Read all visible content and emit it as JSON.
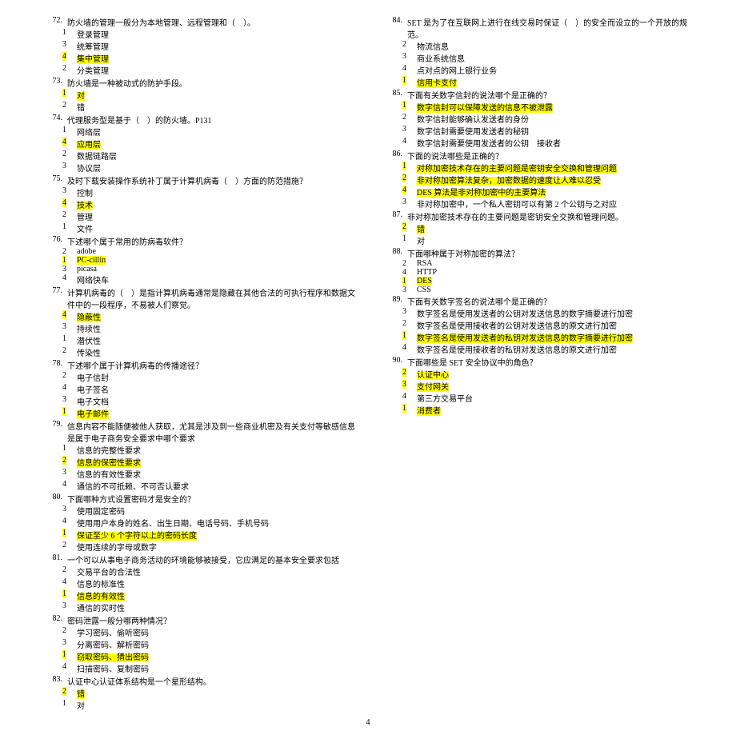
{
  "page_number": "4",
  "left": [
    {
      "n": "72.",
      "t": "防火墙的管理一般分为本地管理、远程管理和（　）。",
      "opts": [
        {
          "n": "1",
          "t": "登录管理",
          "hl": false
        },
        {
          "n": "3",
          "t": "统筹管理",
          "hl": false
        },
        {
          "n": "4",
          "t": "集中管理",
          "hl": true
        },
        {
          "n": "2",
          "t": "分类管理",
          "hl": false
        }
      ]
    },
    {
      "n": "73.",
      "t": "防火墙是一种被动式的防护手段。",
      "opts": [
        {
          "n": "1",
          "t": "对",
          "hl": true
        },
        {
          "n": "2",
          "t": "错",
          "hl": false
        }
      ]
    },
    {
      "n": "74.",
      "t": "代理服务型是基于（　）的防火墙。P131",
      "opts": [
        {
          "n": "1",
          "t": "网络层",
          "hl": false
        },
        {
          "n": "4",
          "t": "应用层",
          "hl": true
        },
        {
          "n": "2",
          "t": "数据链路层",
          "hl": false
        },
        {
          "n": "3",
          "t": "协议层",
          "hl": false
        }
      ]
    },
    {
      "n": "75.",
      "t": "及时下载安装操作系统补丁属于计算机病毒（　）方面的防范措施？",
      "opts": [
        {
          "n": "3",
          "t": "控制",
          "hl": false
        },
        {
          "n": "4",
          "t": "技术",
          "hl": true
        },
        {
          "n": "2",
          "t": "管理",
          "hl": false
        },
        {
          "n": "1",
          "t": "文件",
          "hl": false
        }
      ]
    },
    {
      "n": "76.",
      "t": "下述哪个属于常用的防病毒软件？",
      "opts": [
        {
          "n": "2",
          "t": "adobe",
          "hl": false
        },
        {
          "n": "1",
          "t": "PC-cillin",
          "hl": true
        },
        {
          "n": "3",
          "t": "picasa",
          "hl": false
        },
        {
          "n": "4",
          "t": "网络快车",
          "hl": false
        }
      ]
    },
    {
      "n": "77.",
      "t": "计算机病毒的（　）是指计算机病毒通常是隐藏在其他合法的可执行程序和数据文件中的一段程序，不易被人们察觉。",
      "opts": [
        {
          "n": "4",
          "t": "隐蔽性",
          "hl": true
        },
        {
          "n": "3",
          "t": "持续性",
          "hl": false
        },
        {
          "n": "1",
          "t": "潜伏性",
          "hl": false
        },
        {
          "n": "2",
          "t": "传染性",
          "hl": false
        }
      ]
    },
    {
      "n": "78.",
      "t": "下述哪个属于计算机病毒的传播途径？",
      "opts": [
        {
          "n": "2",
          "t": "电子信封",
          "hl": false
        },
        {
          "n": "4",
          "t": "电子签名",
          "hl": false
        },
        {
          "n": "3",
          "t": "电子文档",
          "hl": false
        },
        {
          "n": "1",
          "t": "电子邮件",
          "hl": true
        }
      ]
    },
    {
      "n": "79.",
      "t": "信息内容不能随便被他人获取，尤其是涉及到一些商业机密及有关支付等敏感信息是属于电子商务安全要求中哪个要求",
      "opts": [
        {
          "n": "1",
          "t": "信息的完整性要求",
          "hl": false
        },
        {
          "n": "2",
          "t": "信息的保密性要求",
          "hl": true
        },
        {
          "n": "3",
          "t": "信息的有效性要求",
          "hl": false
        },
        {
          "n": "4",
          "t": "通信的不可抵赖、不可否认要求",
          "hl": false
        }
      ]
    },
    {
      "n": "80.",
      "t": "下面哪种方式设置密码才是安全的？",
      "opts": [
        {
          "n": "3",
          "t": "使用固定密码",
          "hl": false
        },
        {
          "n": "4",
          "t": "使用用户本身的姓名、出生日期、电话号码、手机号码",
          "hl": false
        },
        {
          "n": "1",
          "t": "保证至少 6 个字符以上的密码长度",
          "hl": true
        },
        {
          "n": "2",
          "t": "使用连续的字母或数字",
          "hl": false
        }
      ]
    },
    {
      "n": "81.",
      "t": "一个可以从事电子商务活动的环境能够被接受，它应满足的基本安全要求包括",
      "opts": [
        {
          "n": "2",
          "t": "交易平台的合法性",
          "hl": false
        },
        {
          "n": "4",
          "t": "信息的标准性",
          "hl": false
        },
        {
          "n": "1",
          "t": "信息的有效性",
          "hl": true
        },
        {
          "n": "3",
          "t": "通信的实时性",
          "hl": false
        }
      ]
    },
    {
      "n": "82.",
      "t": "密码泄露一般分哪两种情况？",
      "opts": [
        {
          "n": "2",
          "t": "学习密码、偷听密码",
          "hl": false
        },
        {
          "n": "3",
          "t": "分离密码、解析密码",
          "hl": false
        },
        {
          "n": "1",
          "t": "窃取密码、猜出密码",
          "hl": true
        },
        {
          "n": "4",
          "t": "扫描密码、复制密码",
          "hl": false
        }
      ]
    },
    {
      "n": "83.",
      "t": "认证中心认证体系结构是一个星形结构。",
      "opts": [
        {
          "n": "2",
          "t": "错",
          "hl": true
        },
        {
          "n": "1",
          "t": "对",
          "hl": false
        }
      ]
    }
  ],
  "right": [
    {
      "n": "84.",
      "t": "SET 是为了在互联网上进行在线交易时保证（　）的安全而设立的一个开放的规范。",
      "opts": [
        {
          "n": "2",
          "t": "物流信息",
          "hl": false
        },
        {
          "n": "3",
          "t": "商业系统信息",
          "hl": false
        },
        {
          "n": "4",
          "t": "点对点的网上银行业务",
          "hl": false
        },
        {
          "n": "1",
          "t": "信用卡支付",
          "hl": true
        }
      ]
    },
    {
      "n": "85.",
      "t": "下面有关数字信封的说法哪个是正确的？",
      "opts": [
        {
          "n": "1",
          "t": "数字信封可以保障发送的信息不被泄露",
          "hl": true
        },
        {
          "n": "2",
          "t": "数字信封能够确认发送者的身份",
          "hl": false
        },
        {
          "n": "3",
          "t": "数字信封需要使用发送者的秘钥",
          "hl": false
        },
        {
          "n": "4",
          "t": "数字信封需要使用发送者的公钥　接收者",
          "hl": false
        }
      ]
    },
    {
      "n": "86.",
      "t": "下面的说法哪些是正确的？",
      "opts": [
        {
          "n": "1",
          "t": "对称加密技术存在的主要问题是密钥安全交换和管理问题",
          "hl": true
        },
        {
          "n": "2",
          "t": "非对称加密算法复杂，加密数据的速度让人难以忍受",
          "hl": true
        },
        {
          "n": "4",
          "t": "DES 算法是非对称加密中的主要算法",
          "hl": true
        },
        {
          "n": "3",
          "t": "非对称加密中，一个私人密钥可以有第 2 个公钥与之对应",
          "hl": false
        }
      ]
    },
    {
      "n": "87.",
      "t": "非对称加密技术存在的主要问题是密钥安全交换和管理问题。",
      "opts": [
        {
          "n": "2",
          "t": "错",
          "hl": true
        },
        {
          "n": "1",
          "t": "对",
          "hl": false
        }
      ]
    },
    {
      "n": "88.",
      "t": "下面哪种属于对称加密的算法？",
      "opts": [
        {
          "n": "2",
          "t": "RSA",
          "hl": false
        },
        {
          "n": "4",
          "t": "HTTP",
          "hl": false
        },
        {
          "n": "1",
          "t": "DES",
          "hl": true
        },
        {
          "n": "3",
          "t": "CSS",
          "hl": false
        }
      ]
    },
    {
      "n": "89.",
      "t": "下面有关数字签名的说法哪个是正确的？",
      "opts": [
        {
          "n": "3",
          "t": "数字签名是使用发送者的公钥对发送信息的数字摘要进行加密",
          "hl": false
        },
        {
          "n": "2",
          "t": "数字签名是使用接收者的公钥对发送信息的原文进行加密",
          "hl": false
        },
        {
          "n": "1",
          "t": "数字签名是使用发送者的私钥对发送信息的数字摘要进行加密",
          "hl": true
        },
        {
          "n": "4",
          "t": "数字签名是使用接收者的私钥对发送信息的原文进行加密",
          "hl": false
        }
      ]
    },
    {
      "n": "90.",
      "t": "下面哪些是 SET 安全协议中的角色？",
      "opts": [
        {
          "n": "2",
          "t": "认证中心",
          "hl": true
        },
        {
          "n": "3",
          "t": "支付网关",
          "hl": true
        },
        {
          "n": "4",
          "t": "第三方交易平台",
          "hl": false
        },
        {
          "n": "1",
          "t": "消费者",
          "hl": true
        }
      ]
    }
  ]
}
